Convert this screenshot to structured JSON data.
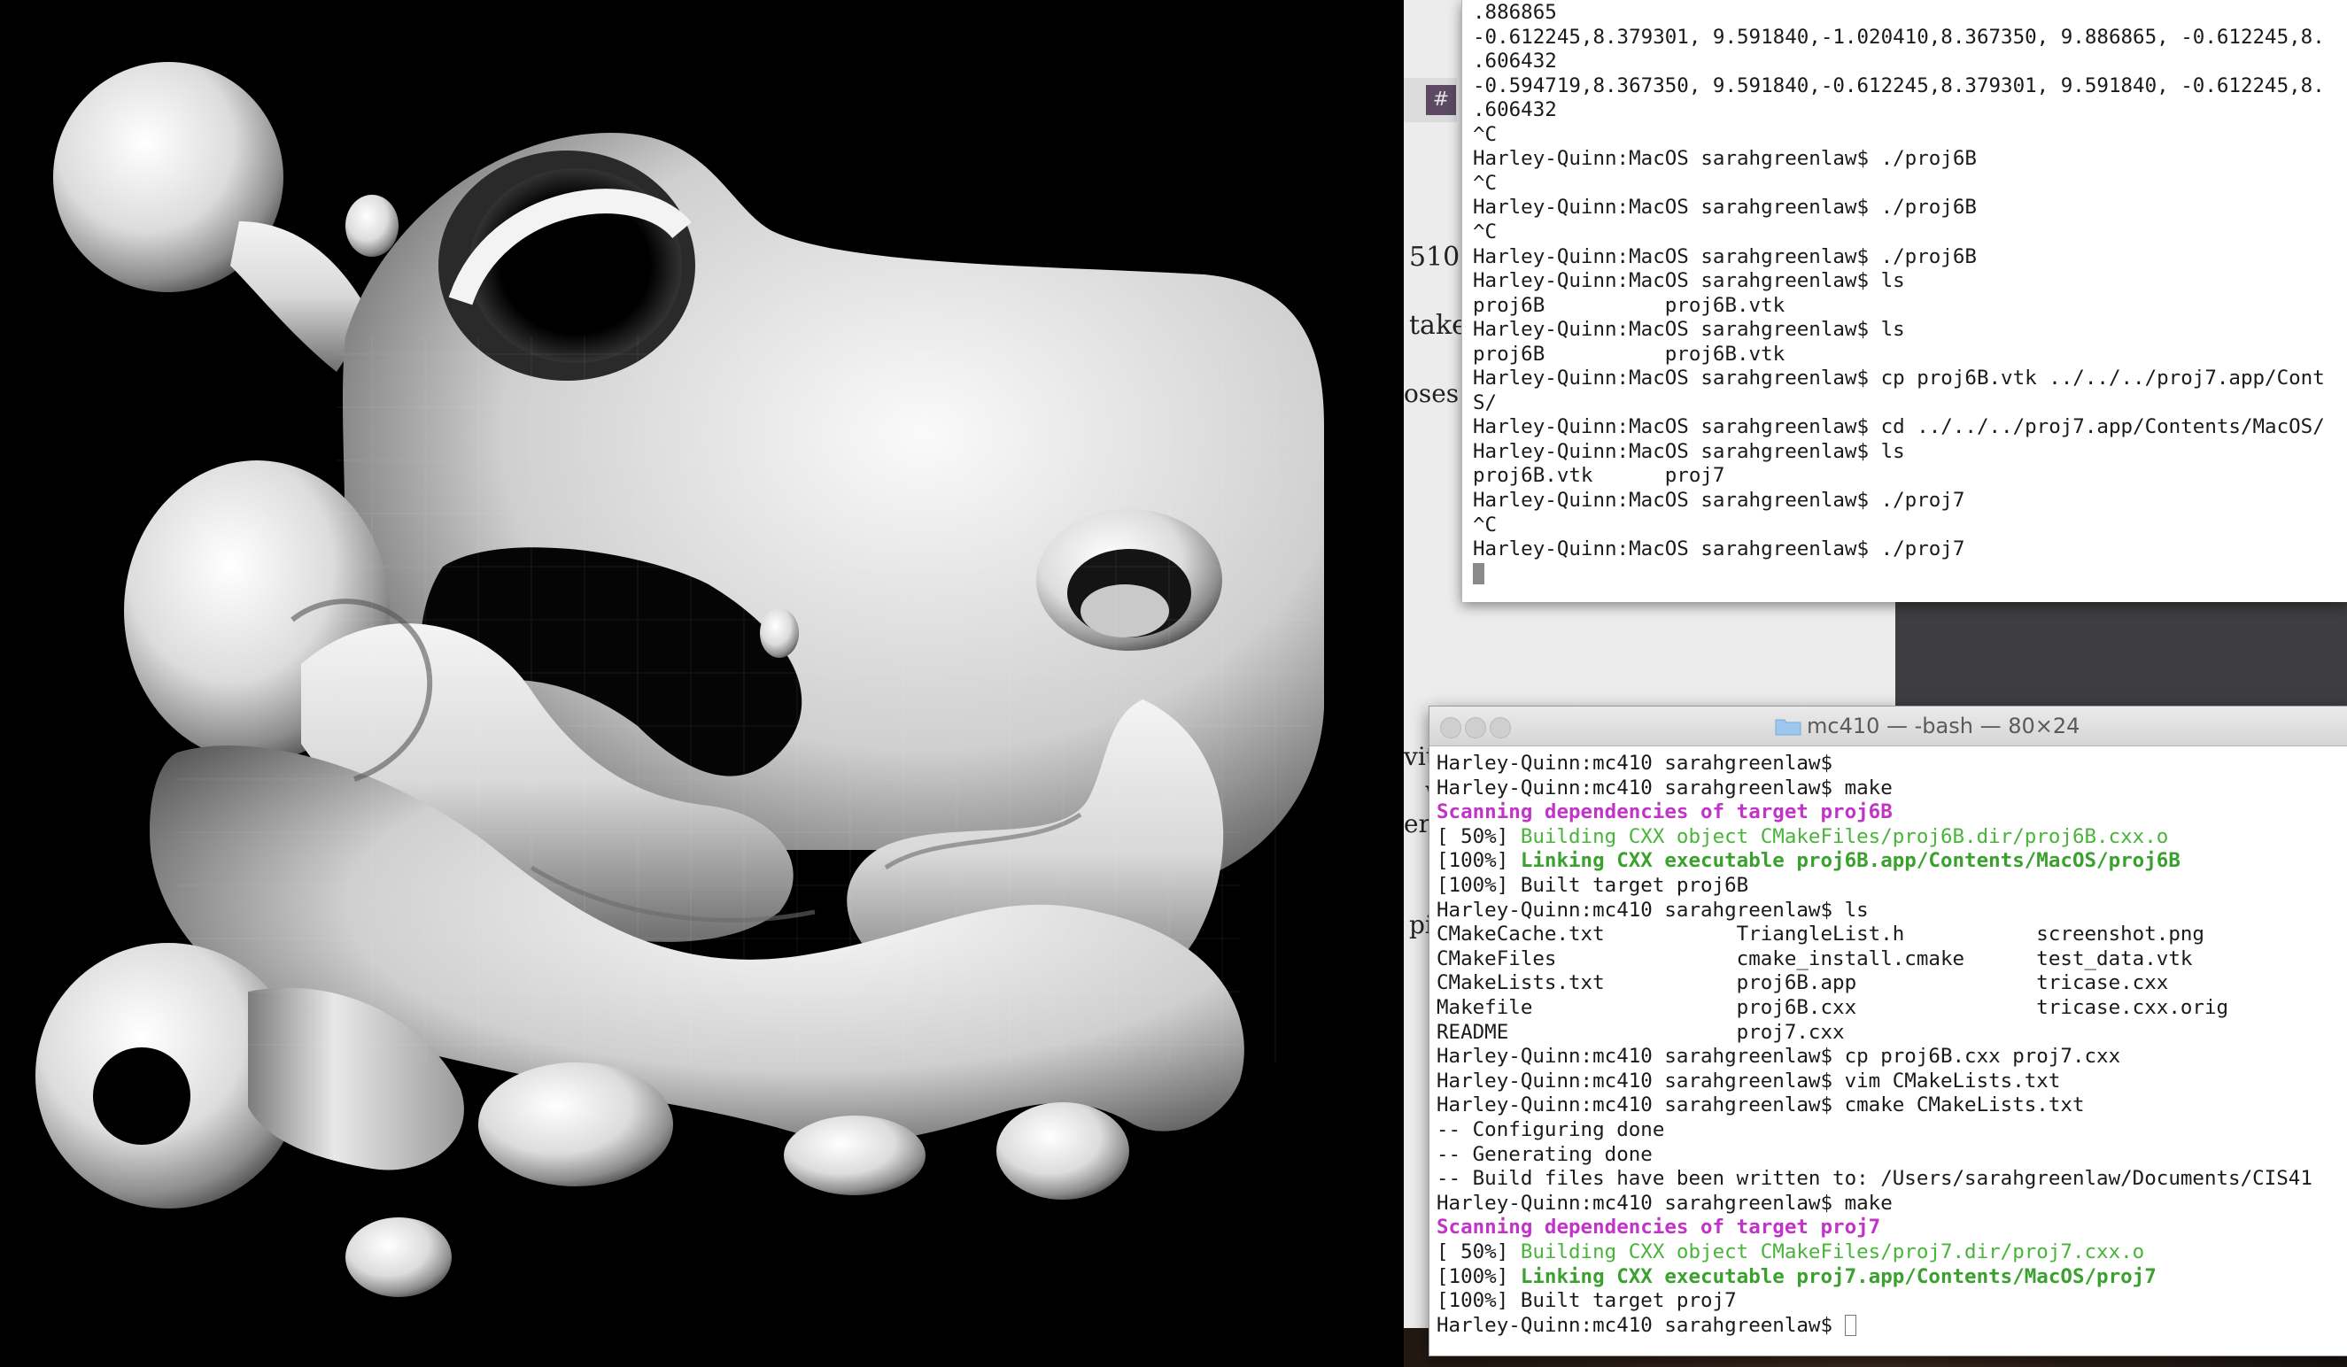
{
  "background_doc": {
    "fragments": [
      "510",
      "take",
      "oses c",
      "vith",
      "w",
      "ert",
      "pi"
    ],
    "tab_glyph": "#"
  },
  "render_window": {
    "description_icon": "3d-mesh-render"
  },
  "terminal1": {
    "lines": [
      ".886865",
      "-0.612245,8.379301, 9.591840,-1.020410,8.367350, 9.886865, -0.612245,8.",
      ".606432",
      "-0.594719,8.367350, 9.591840,-0.612245,8.379301, 9.591840, -0.612245,8.",
      ".606432",
      "^C",
      "Harley-Quinn:MacOS sarahgreenlaw$ ./proj6B",
      "^C",
      "Harley-Quinn:MacOS sarahgreenlaw$ ./proj6B",
      "^C",
      "Harley-Quinn:MacOS sarahgreenlaw$ ./proj6B",
      "Harley-Quinn:MacOS sarahgreenlaw$ ls",
      "proj6B          proj6B.vtk",
      "Harley-Quinn:MacOS sarahgreenlaw$ ls",
      "proj6B          proj6B.vtk",
      "Harley-Quinn:MacOS sarahgreenlaw$ cp proj6B.vtk ../../../proj7.app/Cont",
      "S/",
      "Harley-Quinn:MacOS sarahgreenlaw$ cd ../../../proj7.app/Contents/MacOS/",
      "Harley-Quinn:MacOS sarahgreenlaw$ ls",
      "proj6B.vtk      proj7",
      "Harley-Quinn:MacOS sarahgreenlaw$ ./proj7",
      "^C",
      "Harley-Quinn:MacOS sarahgreenlaw$ ./proj7",
      ""
    ]
  },
  "terminal2": {
    "title": "mc410 — -bash — 80×24",
    "lines": [
      {
        "t": "Harley-Quinn:mc410 sarahgreenlaw$",
        "s": ""
      },
      {
        "t": "Harley-Quinn:mc410 sarahgreenlaw$ make",
        "s": ""
      },
      {
        "t": "Scanning dependencies of target proj6B",
        "s": "mag"
      },
      {
        "t": "[ 50%] ",
        "s": "",
        "t2": "Building CXX object CMakeFiles/proj6B.dir/proj6B.cxx.o",
        "s2": "grn"
      },
      {
        "t": "[100%] ",
        "s": "",
        "t2": "Linking CXX executable proj6B.app/Contents/MacOS/proj6B",
        "s2": "grnb"
      },
      {
        "t": "[100%] Built target proj6B",
        "s": ""
      },
      {
        "t": "Harley-Quinn:mc410 sarahgreenlaw$ ls",
        "s": ""
      },
      {
        "t": "CMakeCache.txt           TriangleList.h           screenshot.png",
        "s": ""
      },
      {
        "t": "CMakeFiles               cmake_install.cmake      test_data.vtk",
        "s": ""
      },
      {
        "t": "CMakeLists.txt           proj6B.app               tricase.cxx",
        "s": ""
      },
      {
        "t": "Makefile                 proj6B.cxx               tricase.cxx.orig",
        "s": ""
      },
      {
        "t": "README                   proj7.cxx",
        "s": ""
      },
      {
        "t": "Harley-Quinn:mc410 sarahgreenlaw$ cp proj6B.cxx proj7.cxx",
        "s": ""
      },
      {
        "t": "Harley-Quinn:mc410 sarahgreenlaw$ vim CMakeLists.txt",
        "s": ""
      },
      {
        "t": "Harley-Quinn:mc410 sarahgreenlaw$ cmake CMakeLists.txt",
        "s": ""
      },
      {
        "t": "-- Configuring done",
        "s": ""
      },
      {
        "t": "-- Generating done",
        "s": ""
      },
      {
        "t": "-- Build files have been written to: /Users/sarahgreenlaw/Documents/CIS41",
        "s": ""
      },
      {
        "t": "Harley-Quinn:mc410 sarahgreenlaw$ make",
        "s": ""
      },
      {
        "t": "Scanning dependencies of target proj7",
        "s": "mag"
      },
      {
        "t": "[ 50%] ",
        "s": "",
        "t2": "Building CXX object CMakeFiles/proj7.dir/proj7.cxx.o",
        "s2": "grn"
      },
      {
        "t": "[100%] ",
        "s": "",
        "t2": "Linking CXX executable proj7.app/Contents/MacOS/proj7",
        "s2": "grnb"
      },
      {
        "t": "[100%] Built target proj7",
        "s": ""
      },
      {
        "t": "Harley-Quinn:mc410 sarahgreenlaw$ ",
        "s": "",
        "cursor": true
      }
    ]
  },
  "colors": {
    "prompt_magenta": "#c035c8",
    "build_green": "#49b43a",
    "link_green": "#3aa12e"
  }
}
